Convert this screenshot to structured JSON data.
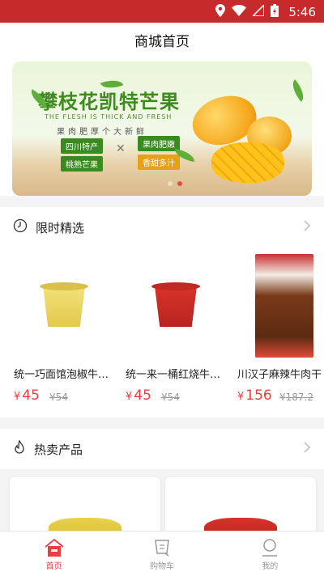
{
  "status": {
    "time": "5:46"
  },
  "header": {
    "title": "商城首页"
  },
  "banner": {
    "title": "攀枝花凯特芒果",
    "subtitle_en": "THE FLESH IS THICK AND FRESH",
    "slogan": "果肉肥厚个大新鲜",
    "tags": [
      "四川特产",
      "果肉肥嫩",
      "桃熟芒果",
      "香甜多汁"
    ],
    "active_dot": 1,
    "dot_count": 2
  },
  "sections": {
    "limited": {
      "title": "限时精选"
    },
    "hot": {
      "title": "热卖产品"
    }
  },
  "products": [
    {
      "name": "统一巧面馆泡椒牛肉面",
      "price": "45",
      "orig": "54",
      "color": "#e8d34a"
    },
    {
      "name": "统一来一桶红烧牛肉面",
      "price": "45",
      "orig": "54",
      "color": "#d8332a"
    },
    {
      "name": "川汉子麻辣牛肉干",
      "price": "156",
      "orig": "187.2",
      "color": "#c93030"
    }
  ],
  "currency": "¥",
  "tabs": [
    {
      "label": "首页",
      "icon": "home-icon",
      "active": true
    },
    {
      "label": "购物车",
      "icon": "cart-icon",
      "active": false
    },
    {
      "label": "我的",
      "icon": "user-icon",
      "active": false
    }
  ],
  "colors": {
    "accent": "#e64040",
    "statusbar": "#c62a2a"
  }
}
